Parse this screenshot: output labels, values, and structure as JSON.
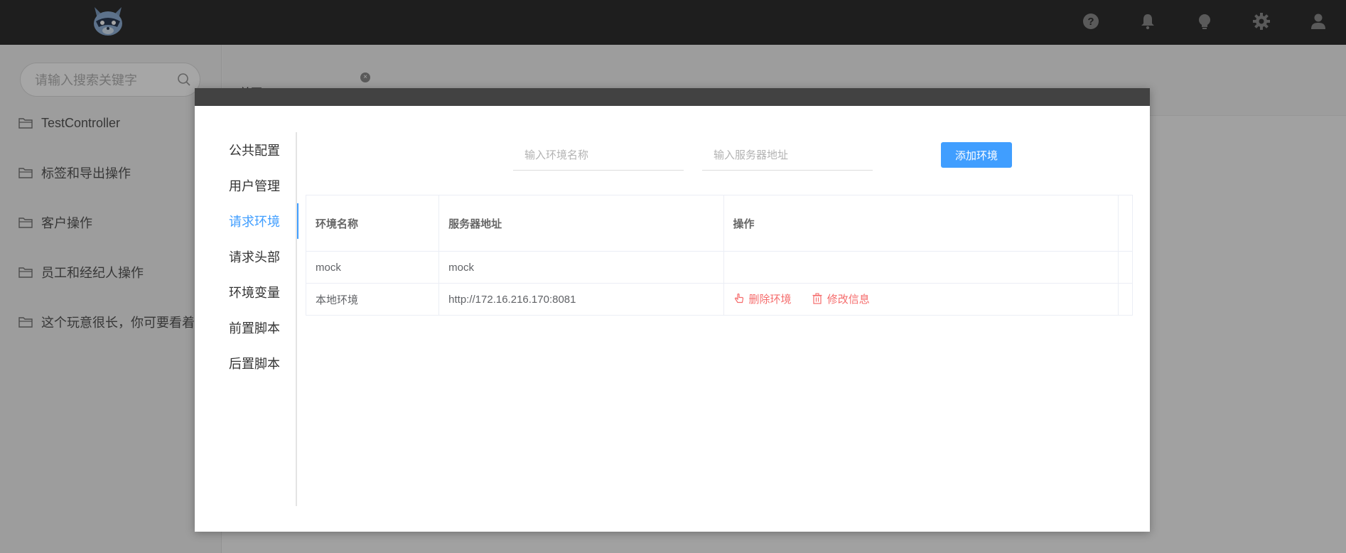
{
  "topbar": {
    "icons": [
      "logo-icon",
      "help-icon",
      "bell-icon",
      "bulb-icon",
      "gear-icon",
      "user-icon"
    ]
  },
  "sidebar": {
    "search_placeholder": "请输入搜索关键字",
    "items": [
      {
        "label": "TestController"
      },
      {
        "label": "标签和导出操作"
      },
      {
        "label": "客户操作"
      },
      {
        "label": "员工和经纪人操作"
      },
      {
        "label": "这个玩意很长，你可要看着..."
      }
    ]
  },
  "tabs": {
    "home": "首页"
  },
  "modal": {
    "nav": [
      {
        "label": "公共配置"
      },
      {
        "label": "用户管理"
      },
      {
        "label": "请求环境",
        "active": true
      },
      {
        "label": "请求头部"
      },
      {
        "label": "环境变量"
      },
      {
        "label": "前置脚本"
      },
      {
        "label": "后置脚本"
      }
    ],
    "env_name_placeholder": "输入环境名称",
    "server_placeholder": "输入服务器地址",
    "add_button": "添加环境",
    "table": {
      "headers": [
        "环境名称",
        "服务器地址",
        "操作"
      ],
      "rows": [
        {
          "name": "mock",
          "server": "mock",
          "actions": false
        },
        {
          "name": "本地环境",
          "server": "http://172.16.216.170:8081",
          "actions": true
        }
      ],
      "delete_label": "删除环境",
      "edit_label": "修改信息"
    }
  },
  "colors": {
    "accent": "#409eff",
    "danger": "#f56c6c",
    "topbar": "#2f2f2f"
  }
}
